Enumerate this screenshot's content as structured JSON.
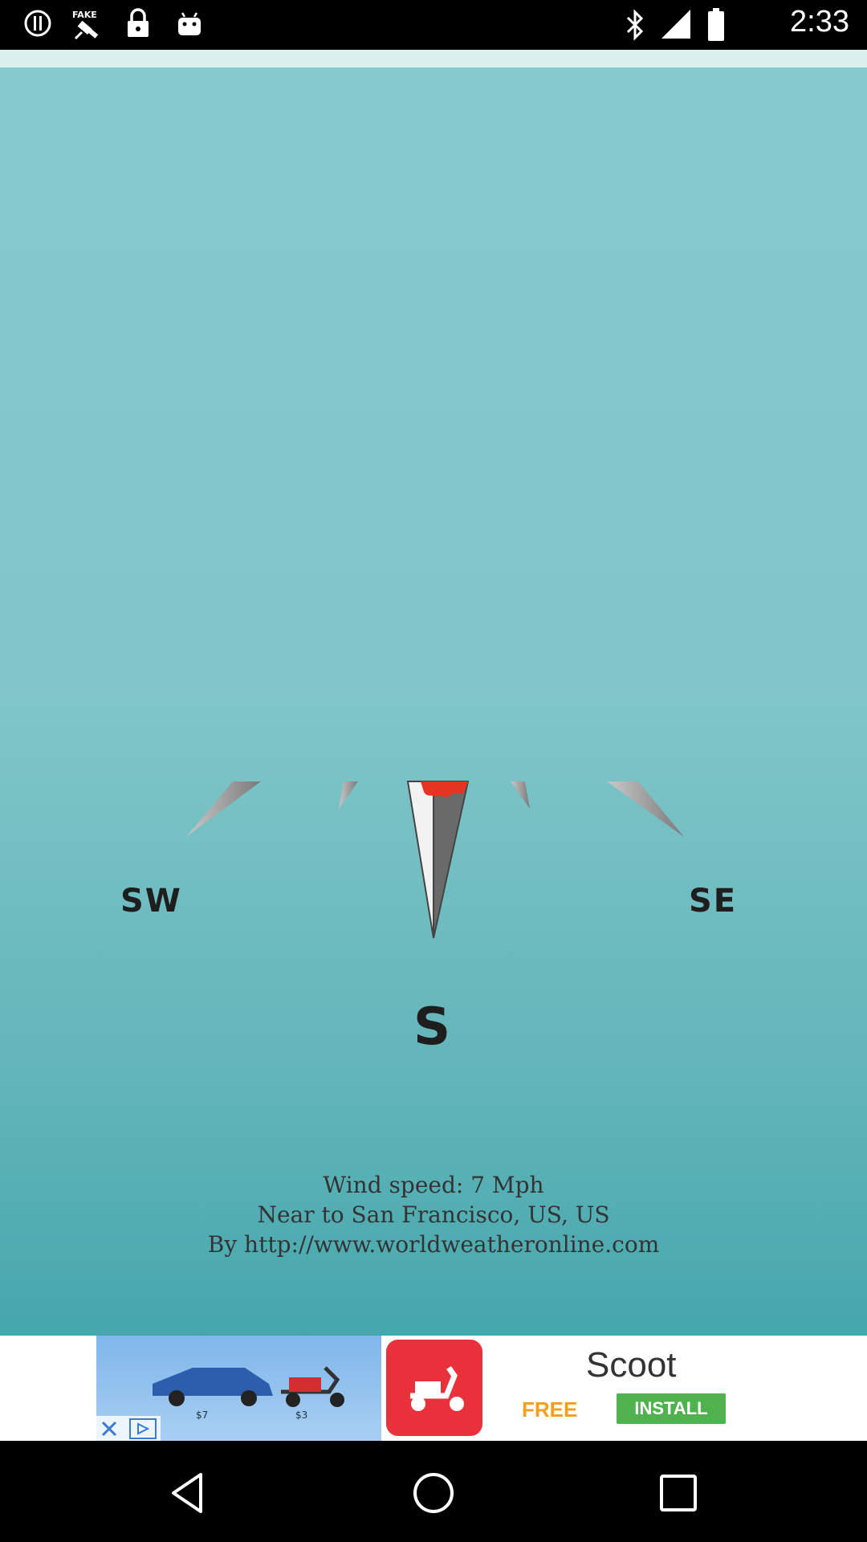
{
  "status_bar": {
    "time": "2:33",
    "icons": [
      "info-circle-icon",
      "fake-gps-satellite-icon",
      "lock-icon",
      "android-icon",
      "bluetooth-icon",
      "signal-icon",
      "battery-icon"
    ]
  },
  "compass": {
    "labels": {
      "sw": "SW",
      "s": "S",
      "se": "SE"
    },
    "needle_direction": "S",
    "needle_tip_color": "#e53522"
  },
  "info": {
    "wind_speed": "Wind speed: 7 Mph",
    "location": "Near to San Francisco, US, US",
    "source": "By http://www.worldweatheronline.com"
  },
  "ad": {
    "title": "Scoot",
    "free_label": "FREE",
    "install_label": "INSTALL",
    "price_1": "$7",
    "price_2": "$3",
    "accent_color": "#e8313a",
    "install_color": "#4fb24e"
  },
  "nav": {
    "buttons": [
      "back-icon",
      "home-icon",
      "recents-icon"
    ]
  }
}
